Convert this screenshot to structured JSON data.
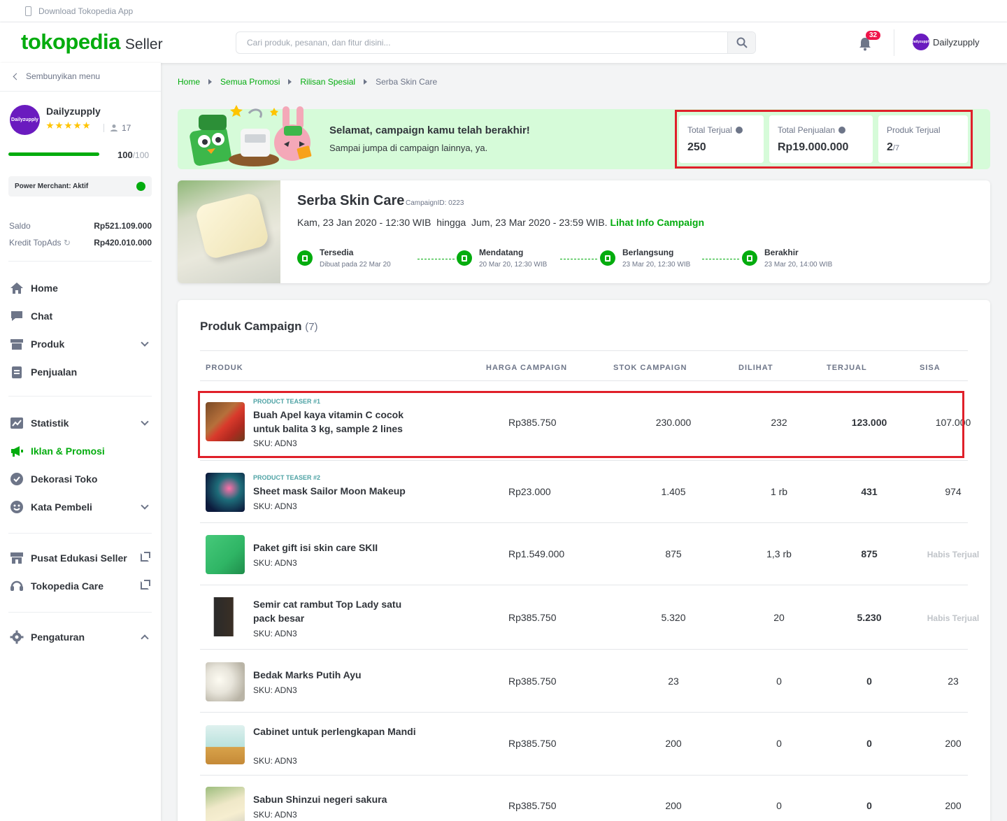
{
  "topstrip": {
    "download_app": "Download Tokopedia App"
  },
  "header": {
    "brand": "tokopedia",
    "brand_suffix": "Seller",
    "search_placeholder": "Cari produk, pesanan, dan fitur disini...",
    "notif_count": "32",
    "user_name": "Dailyzupply"
  },
  "sidebar": {
    "hide_menu": "Sembunyikan menu",
    "shop_name": "Dailyzupply",
    "avatar_text": "Dailyzupply",
    "rating_stars": 5,
    "followers": "17",
    "score": "100",
    "score_max": "/100",
    "score_fraction": 1.0,
    "power_merchant": "Power Merchant: Aktif",
    "saldo_label": "Saldo",
    "saldo_value": "Rp521.109.000",
    "topads_label": "Kredit TopAds",
    "topads_value": "Rp420.010.000",
    "menu": [
      {
        "label": "Home",
        "icon": "home-icon",
        "caret": "none"
      },
      {
        "label": "Chat",
        "icon": "chat-icon",
        "caret": "none"
      },
      {
        "label": "Produk",
        "icon": "box-icon",
        "caret": "down"
      },
      {
        "label": "Penjualan",
        "icon": "clipboard-icon",
        "caret": "none"
      },
      {
        "label": "Statistik",
        "icon": "chart-icon",
        "caret": "down"
      },
      {
        "label": "Iklan & Promosi",
        "icon": "megaphone-icon",
        "caret": "none",
        "active": true
      },
      {
        "label": "Dekorasi Toko",
        "icon": "badge-check-icon",
        "caret": "none"
      },
      {
        "label": "Kata Pembeli",
        "icon": "smile-icon",
        "caret": "down"
      },
      {
        "label": "Pusat Edukasi Seller",
        "icon": "store-icon",
        "caret": "external"
      },
      {
        "label": "Tokopedia Care",
        "icon": "headset-icon",
        "caret": "external"
      },
      {
        "label": "Pengaturan",
        "icon": "gear-icon",
        "caret": "up"
      }
    ]
  },
  "breadcrumb": [
    "Home",
    "Semua Promosi",
    "Rilisan Spesial",
    "Serba Skin Care"
  ],
  "banner": {
    "title": "Selamat, campaign kamu telah berakhir!",
    "subtitle": "Sampai jumpa di campaign lainnya, ya."
  },
  "stats": [
    {
      "label": "Total Terjual",
      "value": "250",
      "info": true
    },
    {
      "label": "Total Penjualan",
      "value": "Rp19.000.000",
      "info": true
    },
    {
      "label": "Produk Terjual",
      "value": "2",
      "denominator": "/7",
      "info": false
    }
  ],
  "campaign": {
    "title": "Serba Skin Care",
    "id_label": "CampaignID: 0223",
    "period": "Kam, 23 Jan 2020 - 12:30 WIB  hingga  Jum, 23 Mar 2020 - 23:59 WIB.",
    "info_link": "Lihat Info Campaign",
    "steps": [
      {
        "name": "Tersedia",
        "date": "Dibuat pada 22 Mar 20"
      },
      {
        "name": "Mendatang",
        "date": "20 Mar 20, 12:30 WIB"
      },
      {
        "name": "Berlangsung",
        "date": "23 Mar 20, 12:30 WIB"
      },
      {
        "name": "Berakhir",
        "date": "23 Mar 20, 14:00 WIB"
      }
    ]
  },
  "products": {
    "title": "Produk Campaign",
    "count": "(7)",
    "columns": [
      "PRODUK",
      "HARGA CAMPAIGN",
      "STOK CAMPAIGN",
      "DILIHAT",
      "TERJUAL",
      "SISA"
    ],
    "rows": [
      {
        "teaser": "PRODUCT TEASER #1",
        "name": "Buah Apel kaya vitamin C cocok untuk balita 3 kg, sample 2 lines",
        "sku": "SKU: ADN3",
        "price": "Rp385.750",
        "stock": "230.000",
        "views": "232",
        "sold": "123.000",
        "rest": "107.000",
        "rest_soldout": false
      },
      {
        "teaser": "PRODUCT TEASER #2",
        "name": "Sheet mask Sailor Moon Makeup",
        "sku": "SKU: ADN3",
        "price": "Rp23.000",
        "stock": "1.405",
        "views": "1 rb",
        "sold": "431",
        "rest": "974",
        "rest_soldout": false
      },
      {
        "teaser": "",
        "name": "Paket gift isi skin care SKII",
        "sku": "SKU: ADN3",
        "price": "Rp1.549.000",
        "stock": "875",
        "views": "1,3 rb",
        "sold": "875",
        "rest": "Habis Terjual",
        "rest_soldout": true
      },
      {
        "teaser": "",
        "name": "Semir cat rambut Top Lady satu pack besar",
        "sku": "SKU: ADN3",
        "price": "Rp385.750",
        "stock": "5.320",
        "views": "20",
        "sold": "5.230",
        "rest": "Habis Terjual",
        "rest_soldout": true
      },
      {
        "teaser": "",
        "name": "Bedak Marks Putih Ayu",
        "sku": "SKU: ADN3",
        "price": "Rp385.750",
        "stock": "23",
        "views": "0",
        "sold": "0",
        "rest": "23",
        "rest_soldout": false
      },
      {
        "teaser": "",
        "name": "Cabinet untuk perlengkapan Mandi",
        "sku": "SKU: ADN3",
        "price": "Rp385.750",
        "stock": "200",
        "views": "0",
        "sold": "0",
        "rest": "200",
        "rest_soldout": false
      },
      {
        "teaser": "",
        "name": "Sabun Shinzui negeri sakura",
        "sku": "SKU: ADN3",
        "price": "Rp385.750",
        "stock": "200",
        "views": "0",
        "sold": "0",
        "rest": "200",
        "rest_soldout": false
      }
    ]
  },
  "colors": {
    "brand_green": "#03ac0e",
    "highlight_red": "#e0202a",
    "badge_red": "#ef144a",
    "banner_bg": "#d6fbd9"
  }
}
